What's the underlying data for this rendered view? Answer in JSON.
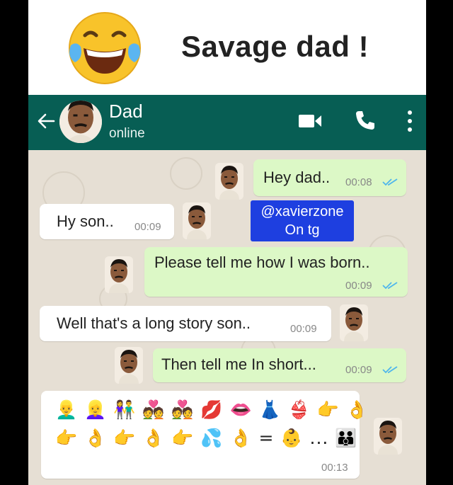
{
  "meme": {
    "title": "Savage dad !",
    "emoji_icon": "face-with-tears-of-joy"
  },
  "contact": {
    "name": "Dad",
    "status": "online"
  },
  "watermark": {
    "line1": "@xavierzone",
    "line2": "On tg"
  },
  "messages": [
    {
      "side": "out",
      "text": "Hey dad..",
      "time": "00:08",
      "read": true
    },
    {
      "side": "in",
      "text": "Hy son..",
      "time": "00:09"
    },
    {
      "side": "out",
      "text": "Please tell me how I was born..",
      "time": "00:09",
      "read": true
    },
    {
      "side": "in",
      "text": "Well that's a long story son..",
      "time": "00:09"
    },
    {
      "side": "out",
      "text": "Then tell me In short...",
      "time": "00:09",
      "read": true
    },
    {
      "side": "in",
      "emoji_row1": "👱‍♂️ 👱‍♀️ 👫 💑 💑 💋 👄 👗 👙 👉 👌",
      "emoji_row2": "👉 👌 👉 👌 👉 💦 👌 = 👶 ... 👪",
      "time": "00:13"
    }
  ],
  "colors": {
    "header": "#075e54",
    "outgoing_bubble": "#dcf8c6",
    "incoming_bubble": "#ffffff",
    "chat_bg": "#e6dfd4",
    "tick_blue": "#4fb6ec",
    "watermark_bg": "#1e3fe0"
  }
}
